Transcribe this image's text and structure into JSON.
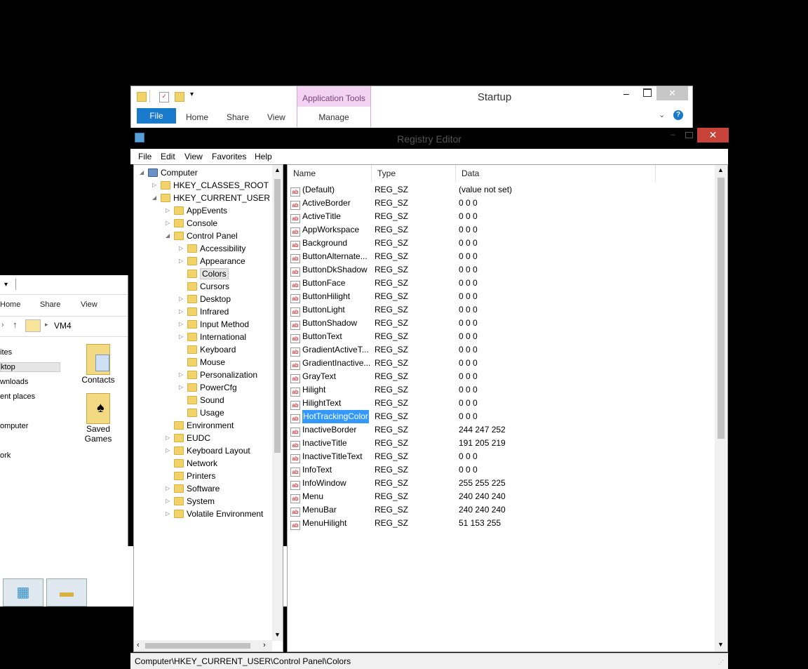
{
  "explorer": {
    "tabs": [
      "Home",
      "Share",
      "View"
    ],
    "address": "VM4",
    "nav": [
      "ites",
      "ktop",
      "wnloads",
      "ent places",
      "omputer",
      "ork"
    ],
    "icons": [
      {
        "label": "Contacts"
      },
      {
        "label": "Saved Games"
      }
    ]
  },
  "startup": {
    "title": "Startup",
    "context_group": "Application Tools",
    "context_tab": "Manage",
    "tabs": {
      "file": "File",
      "home": "Home",
      "share": "Share",
      "view": "View"
    },
    "help_icon": "?"
  },
  "regedit": {
    "title": "Registry Editor",
    "menu": [
      "File",
      "Edit",
      "View",
      "Favorites",
      "Help"
    ],
    "tree": [
      {
        "label": "Computer",
        "level": 0,
        "exp": "open"
      },
      {
        "label": "HKEY_CLASSES_ROOT",
        "level": 1,
        "exp": "closed"
      },
      {
        "label": "HKEY_CURRENT_USER",
        "level": 1,
        "exp": "open"
      },
      {
        "label": "AppEvents",
        "level": 2,
        "exp": "closed"
      },
      {
        "label": "Console",
        "level": 2,
        "exp": "closed"
      },
      {
        "label": "Control Panel",
        "level": 2,
        "exp": "open"
      },
      {
        "label": "Accessibility",
        "level": 3,
        "exp": "closed"
      },
      {
        "label": "Appearance",
        "level": 3,
        "exp": "closed"
      },
      {
        "label": "Colors",
        "level": 3,
        "exp": "none",
        "selected": true
      },
      {
        "label": "Cursors",
        "level": 3,
        "exp": "none"
      },
      {
        "label": "Desktop",
        "level": 3,
        "exp": "closed"
      },
      {
        "label": "Infrared",
        "level": 3,
        "exp": "closed"
      },
      {
        "label": "Input Method",
        "level": 3,
        "exp": "closed"
      },
      {
        "label": "International",
        "level": 3,
        "exp": "closed"
      },
      {
        "label": "Keyboard",
        "level": 3,
        "exp": "none"
      },
      {
        "label": "Mouse",
        "level": 3,
        "exp": "none"
      },
      {
        "label": "Personalization",
        "level": 3,
        "exp": "closed"
      },
      {
        "label": "PowerCfg",
        "level": 3,
        "exp": "closed"
      },
      {
        "label": "Sound",
        "level": 3,
        "exp": "none"
      },
      {
        "label": "Usage",
        "level": 3,
        "exp": "none"
      },
      {
        "label": "Environment",
        "level": 2,
        "exp": "none"
      },
      {
        "label": "EUDC",
        "level": 2,
        "exp": "closed"
      },
      {
        "label": "Keyboard Layout",
        "level": 2,
        "exp": "closed"
      },
      {
        "label": "Network",
        "level": 2,
        "exp": "none"
      },
      {
        "label": "Printers",
        "level": 2,
        "exp": "none"
      },
      {
        "label": "Software",
        "level": 2,
        "exp": "closed"
      },
      {
        "label": "System",
        "level": 2,
        "exp": "closed"
      },
      {
        "label": "Volatile Environment",
        "level": 2,
        "exp": "closed"
      }
    ],
    "columns": [
      "Name",
      "Type",
      "Data"
    ],
    "values": [
      {
        "name": "(Default)",
        "type": "REG_SZ",
        "data": "(value not set)"
      },
      {
        "name": "ActiveBorder",
        "type": "REG_SZ",
        "data": "0 0 0"
      },
      {
        "name": "ActiveTitle",
        "type": "REG_SZ",
        "data": "0 0 0"
      },
      {
        "name": "AppWorkspace",
        "type": "REG_SZ",
        "data": "0 0 0"
      },
      {
        "name": "Background",
        "type": "REG_SZ",
        "data": "0 0 0"
      },
      {
        "name": "ButtonAlternate...",
        "type": "REG_SZ",
        "data": "0 0 0"
      },
      {
        "name": "ButtonDkShadow",
        "type": "REG_SZ",
        "data": "0 0 0"
      },
      {
        "name": "ButtonFace",
        "type": "REG_SZ",
        "data": "0 0 0"
      },
      {
        "name": "ButtonHilight",
        "type": "REG_SZ",
        "data": "0 0 0"
      },
      {
        "name": "ButtonLight",
        "type": "REG_SZ",
        "data": "0 0 0"
      },
      {
        "name": "ButtonShadow",
        "type": "REG_SZ",
        "data": "0 0 0"
      },
      {
        "name": "ButtonText",
        "type": "REG_SZ",
        "data": "0 0 0"
      },
      {
        "name": "GradientActiveT...",
        "type": "REG_SZ",
        "data": "0 0 0"
      },
      {
        "name": "GradientInactive...",
        "type": "REG_SZ",
        "data": "0 0 0"
      },
      {
        "name": "GrayText",
        "type": "REG_SZ",
        "data": "0 0 0"
      },
      {
        "name": "Hilight",
        "type": "REG_SZ",
        "data": "0 0 0"
      },
      {
        "name": "HilightText",
        "type": "REG_SZ",
        "data": "0 0 0"
      },
      {
        "name": "HotTrackingColor",
        "type": "REG_SZ",
        "data": "0 0 0",
        "selected": true
      },
      {
        "name": "InactiveBorder",
        "type": "REG_SZ",
        "data": "244 247 252"
      },
      {
        "name": "InactiveTitle",
        "type": "REG_SZ",
        "data": "191 205 219"
      },
      {
        "name": "InactiveTitleText",
        "type": "REG_SZ",
        "data": "0 0 0"
      },
      {
        "name": "InfoText",
        "type": "REG_SZ",
        "data": "0 0 0"
      },
      {
        "name": "InfoWindow",
        "type": "REG_SZ",
        "data": "255 255 225"
      },
      {
        "name": "Menu",
        "type": "REG_SZ",
        "data": "240 240 240"
      },
      {
        "name": "MenuBar",
        "type": "REG_SZ",
        "data": "240 240 240"
      },
      {
        "name": "MenuHilight",
        "type": "REG_SZ",
        "data": "51 153 255"
      }
    ],
    "status": "Computer\\HKEY_CURRENT_USER\\Control Panel\\Colors"
  },
  "colors": {
    "accent": "#1979ca",
    "close": "#c7433a",
    "selection": "#3399ff",
    "context": "#f2d4f2"
  }
}
